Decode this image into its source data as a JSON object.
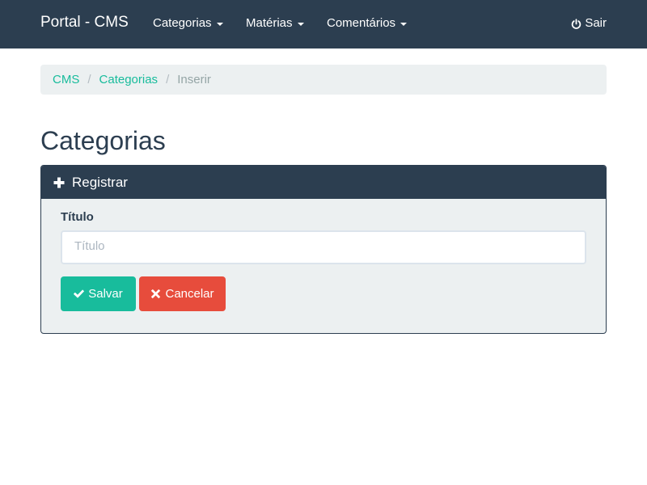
{
  "navbar": {
    "brand": "Portal - CMS",
    "items": [
      {
        "label": "Categorias"
      },
      {
        "label": "Matérias"
      },
      {
        "label": "Comentários"
      }
    ],
    "logout_label": "Sair"
  },
  "breadcrumb": {
    "items": [
      "CMS",
      "Categorias"
    ],
    "active": "Inserir"
  },
  "page": {
    "title": "Categorias"
  },
  "panel": {
    "heading": "Registrar",
    "field_label": "Título",
    "field_placeholder": "Título",
    "field_value": "",
    "save_label": "Salvar",
    "cancel_label": "Cancelar"
  },
  "colors": {
    "navbar_bg": "#2c3e50",
    "accent": "#18bc9c",
    "danger": "#e74c3c",
    "panel_bg": "#ecf0f1"
  },
  "icons": {
    "logout": "power-icon",
    "panel_heading": "plus-icon",
    "save": "check-icon",
    "cancel": "times-icon",
    "dropdown": "caret-down-icon"
  }
}
